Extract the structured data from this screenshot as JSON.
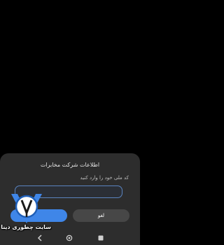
{
  "dialog": {
    "title": "اطلاعات شرکت مخابرات",
    "message": "کد ملی خود را وارد کنید",
    "input_value": "",
    "ok_label": "",
    "cancel_label": "لغو"
  },
  "navbar": {
    "back_icon": "back-icon",
    "home_icon": "home-icon",
    "recent_icon": "recent-apps-icon"
  },
  "watermark": {
    "text": "سایت چطوری دینا"
  },
  "colors": {
    "background": "#000000",
    "dialog": "#2d2d2d",
    "accent": "#3f86e8",
    "input_border": "#5a84c0",
    "cancel": "#474747"
  }
}
